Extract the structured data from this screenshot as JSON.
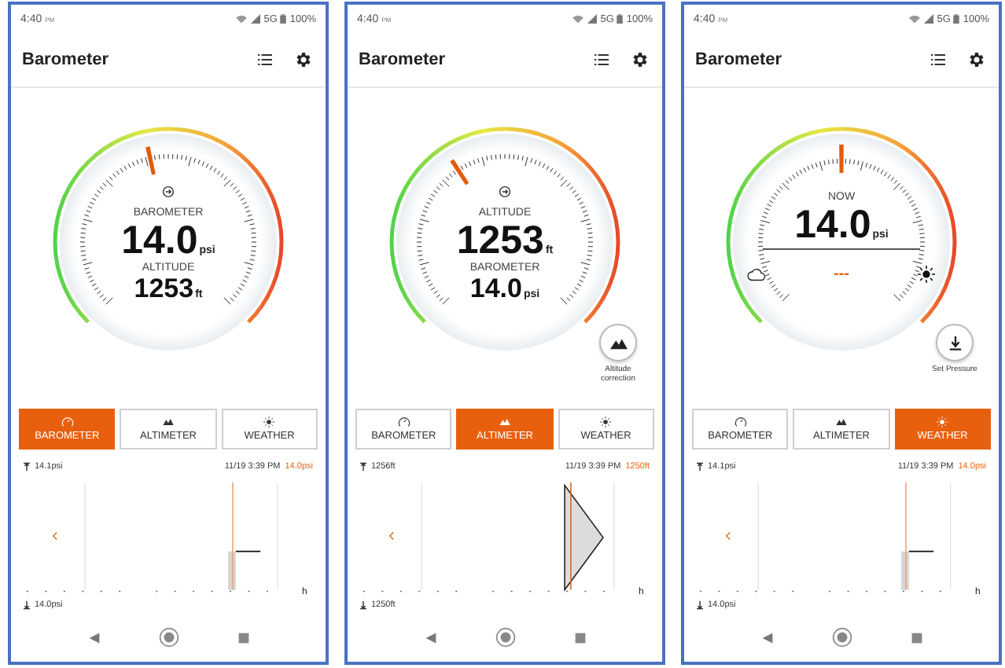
{
  "phones": [
    {
      "status": {
        "time": "4:40",
        "ampm": "PM",
        "network": "5G",
        "battery": "100%"
      },
      "title": "Barometer",
      "gauge": {
        "kind": "dual",
        "level": 0.43,
        "primary_label": "BAROMETER",
        "primary_value": "14.0",
        "primary_unit": "psi",
        "secondary_label": "ALTITUDE",
        "secondary_value": "1253",
        "secondary_unit": "ft"
      },
      "tabs": [
        {
          "label": "BAROMETER",
          "selected": true
        },
        {
          "label": "ALTIMETER",
          "selected": false
        },
        {
          "label": "WEATHER",
          "selected": false
        }
      ],
      "chart": {
        "kind": "step",
        "max_label": "14.1psi",
        "min_label": "14.0psi",
        "time": "11/19 3:39 PM",
        "current": "14.0psi",
        "x_unit": "h"
      }
    },
    {
      "status": {
        "time": "4:40",
        "ampm": "PM",
        "network": "5G",
        "battery": "100%"
      },
      "title": "Barometer",
      "gauge": {
        "kind": "dual",
        "level": 0.32,
        "primary_label": "ALTITUDE",
        "primary_value": "1253",
        "primary_unit": "ft",
        "secondary_label": "BAROMETER",
        "secondary_value": "14.0",
        "secondary_unit": "psi",
        "action": {
          "kind": "mountain",
          "label": "Altitude correction"
        }
      },
      "tabs": [
        {
          "label": "BAROMETER",
          "selected": false
        },
        {
          "label": "ALTIMETER",
          "selected": true
        },
        {
          "label": "WEATHER",
          "selected": false
        }
      ],
      "chart": {
        "kind": "wedge",
        "max_label": "1256ft",
        "min_label": "1250ft",
        "time": "11/19 3:39 PM",
        "current": "1250ft",
        "x_unit": "h"
      }
    },
    {
      "status": {
        "time": "4:40",
        "ampm": "PM",
        "network": "5G",
        "battery": "100%"
      },
      "title": "Barometer",
      "gauge": {
        "kind": "weather",
        "level": 0.5,
        "primary_label": "NOW",
        "primary_value": "14.0",
        "primary_unit": "psi",
        "trend": "---",
        "action": {
          "kind": "download",
          "label": "Set Pressure"
        }
      },
      "tabs": [
        {
          "label": "BAROMETER",
          "selected": false
        },
        {
          "label": "ALTIMETER",
          "selected": false
        },
        {
          "label": "WEATHER",
          "selected": true
        }
      ],
      "chart": {
        "kind": "step",
        "max_label": "14.1psi",
        "min_label": "14.0psi",
        "time": "11/19 3:39 PM",
        "current": "14.0psi",
        "x_unit": "h"
      }
    }
  ]
}
